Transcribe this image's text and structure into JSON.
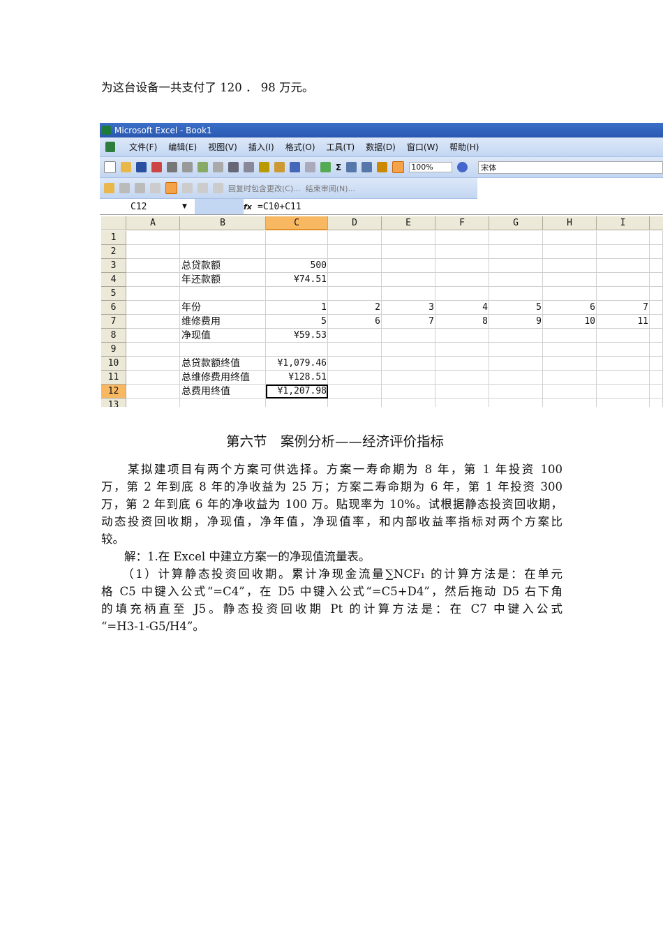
{
  "intro_line": "为这台设备一共支付了 120 ． 98 万元。",
  "excel": {
    "title": "Microsoft Excel - Book1",
    "menu": [
      "文件(F)",
      "编辑(E)",
      "视图(V)",
      "插入(I)",
      "格式(O)",
      "工具(T)",
      "数据(D)",
      "窗口(W)",
      "帮助(H)"
    ],
    "zoom": "100%",
    "font": "宋体",
    "review_reply": "回复时包含更改(C)...",
    "review_end": "结束审阅(N)...",
    "name_box": "C12",
    "fx": "fx",
    "formula": "=C10+C11",
    "columns": [
      "A",
      "B",
      "C",
      "D",
      "E",
      "F",
      "G",
      "H",
      "I"
    ],
    "rows": [
      "1",
      "2",
      "3",
      "4",
      "5",
      "6",
      "7",
      "8",
      "9",
      "10",
      "11",
      "12",
      "13"
    ],
    "cells": [
      {
        "row": 3,
        "col": "B",
        "v": "总贷款额"
      },
      {
        "row": 3,
        "col": "C",
        "v": "500"
      },
      {
        "row": 4,
        "col": "B",
        "v": "年还款额"
      },
      {
        "row": 4,
        "col": "C",
        "v": "¥74.51"
      },
      {
        "row": 6,
        "col": "B",
        "v": "年份"
      },
      {
        "row": 6,
        "col": "C",
        "v": "1"
      },
      {
        "row": 6,
        "col": "D",
        "v": "2"
      },
      {
        "row": 6,
        "col": "E",
        "v": "3"
      },
      {
        "row": 6,
        "col": "F",
        "v": "4"
      },
      {
        "row": 6,
        "col": "G",
        "v": "5"
      },
      {
        "row": 6,
        "col": "H",
        "v": "6"
      },
      {
        "row": 6,
        "col": "I",
        "v": "7"
      },
      {
        "row": 7,
        "col": "B",
        "v": "维修费用"
      },
      {
        "row": 7,
        "col": "C",
        "v": "5"
      },
      {
        "row": 7,
        "col": "D",
        "v": "6"
      },
      {
        "row": 7,
        "col": "E",
        "v": "7"
      },
      {
        "row": 7,
        "col": "F",
        "v": "8"
      },
      {
        "row": 7,
        "col": "G",
        "v": "9"
      },
      {
        "row": 7,
        "col": "H",
        "v": "10"
      },
      {
        "row": 7,
        "col": "I",
        "v": "11"
      },
      {
        "row": 8,
        "col": "B",
        "v": "净现值"
      },
      {
        "row": 8,
        "col": "C",
        "v": "¥59.53"
      },
      {
        "row": 10,
        "col": "B",
        "v": "总贷款额终值"
      },
      {
        "row": 10,
        "col": "C",
        "v": "¥1,079.46"
      },
      {
        "row": 11,
        "col": "B",
        "v": "总维修费用终值"
      },
      {
        "row": 11,
        "col": "C",
        "v": "¥128.51"
      },
      {
        "row": 12,
        "col": "B",
        "v": "总费用终值"
      },
      {
        "row": 12,
        "col": "C",
        "v": "¥1,207.98"
      }
    ]
  },
  "heading": "第六节　案例分析——经济评价指标",
  "para1": [
    "　　某拟建项目有两个方案可供选择。方案一寿命期为 8 年，第 1 年投资 100",
    "万，第 2 年到底 8 年的净收益为 25 万；方案二寿命期为 6 年，第 1 年投资 300",
    "万，第 2 年到底 6 年的净收益为 100 万。贴现率为 10%。试根据静态投资回收期，",
    "动态投资回收期，净现值，净年值，净现值率，和内部收益率指标对两个方案比",
    "较。"
  ],
  "para2": "　　解：1.在 Excel 中建立方案一的净现值流量表。",
  "para3": [
    "　　（1）计算静态投资回收期。累计净现金流量∑NCF₁ 的计算方法是：在单元",
    "格 C5 中键入公式“=C4”，在 D5 中键入公式“=C5+D4”，然后拖动 D5 右下角",
    "的填充柄直至 J5。静态投资回收期 Pt 的计算方法是：在 C7 中键入公式",
    "“=H3-1-G5/H4”。"
  ]
}
